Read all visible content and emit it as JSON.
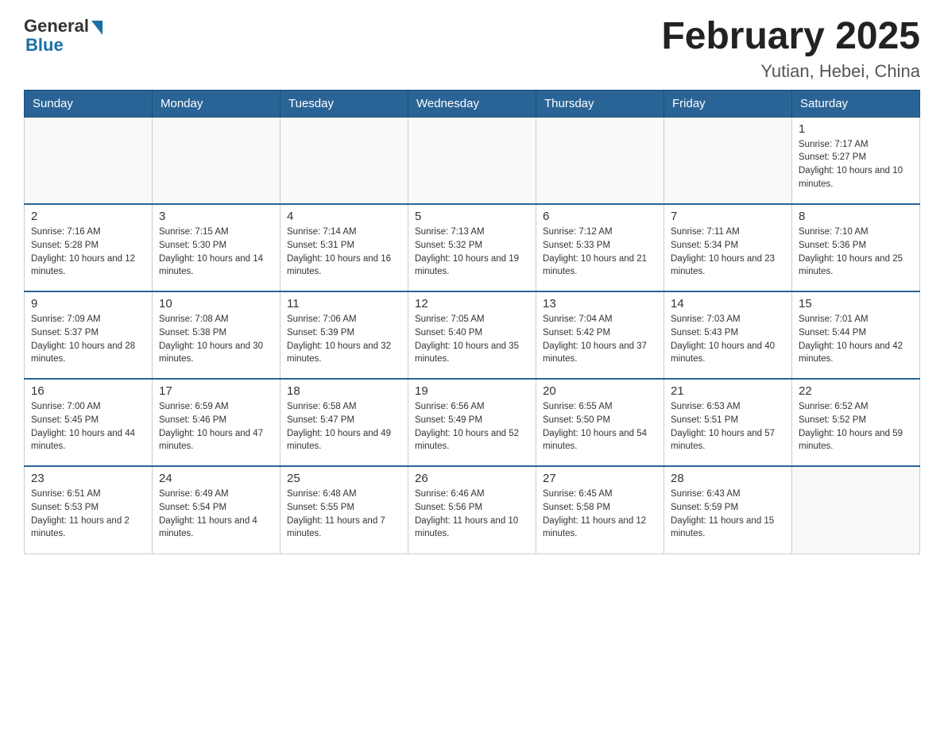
{
  "header": {
    "logo_general": "General",
    "logo_blue": "Blue",
    "title": "February 2025",
    "subtitle": "Yutian, Hebei, China"
  },
  "weekdays": [
    "Sunday",
    "Monday",
    "Tuesday",
    "Wednesday",
    "Thursday",
    "Friday",
    "Saturday"
  ],
  "weeks": [
    [
      {
        "day": "",
        "sunrise": "",
        "sunset": "",
        "daylight": ""
      },
      {
        "day": "",
        "sunrise": "",
        "sunset": "",
        "daylight": ""
      },
      {
        "day": "",
        "sunrise": "",
        "sunset": "",
        "daylight": ""
      },
      {
        "day": "",
        "sunrise": "",
        "sunset": "",
        "daylight": ""
      },
      {
        "day": "",
        "sunrise": "",
        "sunset": "",
        "daylight": ""
      },
      {
        "day": "",
        "sunrise": "",
        "sunset": "",
        "daylight": ""
      },
      {
        "day": "1",
        "sunrise": "Sunrise: 7:17 AM",
        "sunset": "Sunset: 5:27 PM",
        "daylight": "Daylight: 10 hours and 10 minutes."
      }
    ],
    [
      {
        "day": "2",
        "sunrise": "Sunrise: 7:16 AM",
        "sunset": "Sunset: 5:28 PM",
        "daylight": "Daylight: 10 hours and 12 minutes."
      },
      {
        "day": "3",
        "sunrise": "Sunrise: 7:15 AM",
        "sunset": "Sunset: 5:30 PM",
        "daylight": "Daylight: 10 hours and 14 minutes."
      },
      {
        "day": "4",
        "sunrise": "Sunrise: 7:14 AM",
        "sunset": "Sunset: 5:31 PM",
        "daylight": "Daylight: 10 hours and 16 minutes."
      },
      {
        "day": "5",
        "sunrise": "Sunrise: 7:13 AM",
        "sunset": "Sunset: 5:32 PM",
        "daylight": "Daylight: 10 hours and 19 minutes."
      },
      {
        "day": "6",
        "sunrise": "Sunrise: 7:12 AM",
        "sunset": "Sunset: 5:33 PM",
        "daylight": "Daylight: 10 hours and 21 minutes."
      },
      {
        "day": "7",
        "sunrise": "Sunrise: 7:11 AM",
        "sunset": "Sunset: 5:34 PM",
        "daylight": "Daylight: 10 hours and 23 minutes."
      },
      {
        "day": "8",
        "sunrise": "Sunrise: 7:10 AM",
        "sunset": "Sunset: 5:36 PM",
        "daylight": "Daylight: 10 hours and 25 minutes."
      }
    ],
    [
      {
        "day": "9",
        "sunrise": "Sunrise: 7:09 AM",
        "sunset": "Sunset: 5:37 PM",
        "daylight": "Daylight: 10 hours and 28 minutes."
      },
      {
        "day": "10",
        "sunrise": "Sunrise: 7:08 AM",
        "sunset": "Sunset: 5:38 PM",
        "daylight": "Daylight: 10 hours and 30 minutes."
      },
      {
        "day": "11",
        "sunrise": "Sunrise: 7:06 AM",
        "sunset": "Sunset: 5:39 PM",
        "daylight": "Daylight: 10 hours and 32 minutes."
      },
      {
        "day": "12",
        "sunrise": "Sunrise: 7:05 AM",
        "sunset": "Sunset: 5:40 PM",
        "daylight": "Daylight: 10 hours and 35 minutes."
      },
      {
        "day": "13",
        "sunrise": "Sunrise: 7:04 AM",
        "sunset": "Sunset: 5:42 PM",
        "daylight": "Daylight: 10 hours and 37 minutes."
      },
      {
        "day": "14",
        "sunrise": "Sunrise: 7:03 AM",
        "sunset": "Sunset: 5:43 PM",
        "daylight": "Daylight: 10 hours and 40 minutes."
      },
      {
        "day": "15",
        "sunrise": "Sunrise: 7:01 AM",
        "sunset": "Sunset: 5:44 PM",
        "daylight": "Daylight: 10 hours and 42 minutes."
      }
    ],
    [
      {
        "day": "16",
        "sunrise": "Sunrise: 7:00 AM",
        "sunset": "Sunset: 5:45 PM",
        "daylight": "Daylight: 10 hours and 44 minutes."
      },
      {
        "day": "17",
        "sunrise": "Sunrise: 6:59 AM",
        "sunset": "Sunset: 5:46 PM",
        "daylight": "Daylight: 10 hours and 47 minutes."
      },
      {
        "day": "18",
        "sunrise": "Sunrise: 6:58 AM",
        "sunset": "Sunset: 5:47 PM",
        "daylight": "Daylight: 10 hours and 49 minutes."
      },
      {
        "day": "19",
        "sunrise": "Sunrise: 6:56 AM",
        "sunset": "Sunset: 5:49 PM",
        "daylight": "Daylight: 10 hours and 52 minutes."
      },
      {
        "day": "20",
        "sunrise": "Sunrise: 6:55 AM",
        "sunset": "Sunset: 5:50 PM",
        "daylight": "Daylight: 10 hours and 54 minutes."
      },
      {
        "day": "21",
        "sunrise": "Sunrise: 6:53 AM",
        "sunset": "Sunset: 5:51 PM",
        "daylight": "Daylight: 10 hours and 57 minutes."
      },
      {
        "day": "22",
        "sunrise": "Sunrise: 6:52 AM",
        "sunset": "Sunset: 5:52 PM",
        "daylight": "Daylight: 10 hours and 59 minutes."
      }
    ],
    [
      {
        "day": "23",
        "sunrise": "Sunrise: 6:51 AM",
        "sunset": "Sunset: 5:53 PM",
        "daylight": "Daylight: 11 hours and 2 minutes."
      },
      {
        "day": "24",
        "sunrise": "Sunrise: 6:49 AM",
        "sunset": "Sunset: 5:54 PM",
        "daylight": "Daylight: 11 hours and 4 minutes."
      },
      {
        "day": "25",
        "sunrise": "Sunrise: 6:48 AM",
        "sunset": "Sunset: 5:55 PM",
        "daylight": "Daylight: 11 hours and 7 minutes."
      },
      {
        "day": "26",
        "sunrise": "Sunrise: 6:46 AM",
        "sunset": "Sunset: 5:56 PM",
        "daylight": "Daylight: 11 hours and 10 minutes."
      },
      {
        "day": "27",
        "sunrise": "Sunrise: 6:45 AM",
        "sunset": "Sunset: 5:58 PM",
        "daylight": "Daylight: 11 hours and 12 minutes."
      },
      {
        "day": "28",
        "sunrise": "Sunrise: 6:43 AM",
        "sunset": "Sunset: 5:59 PM",
        "daylight": "Daylight: 11 hours and 15 minutes."
      },
      {
        "day": "",
        "sunrise": "",
        "sunset": "",
        "daylight": ""
      }
    ]
  ]
}
